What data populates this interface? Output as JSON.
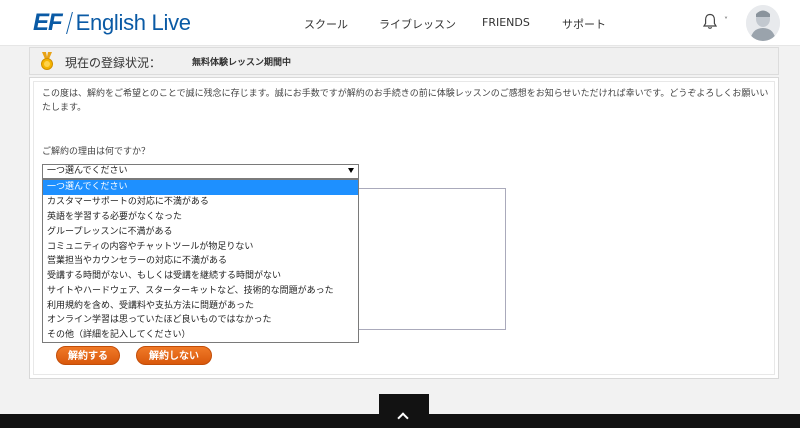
{
  "header": {
    "logo_mark": "EF",
    "logo_text": "English Live",
    "nav": [
      "スクール",
      "ライブレッスン",
      "FRIENDS",
      "サポート"
    ],
    "caret": "˅"
  },
  "status": {
    "label": "現在の登録状況：",
    "value": "無料体験レッスン期間中"
  },
  "form": {
    "intro": "この度は、解約をご希望とのことで誠に残念に存じます。誠にお手数ですが解約のお手続きの前に体験レッスンのご感想をお知らせいただければ幸いです。どうぞよろしくお願いいたします。",
    "reason_label": "ご解約の理由は何ですか？",
    "selected": "一つ選んでください",
    "options": [
      "一つ選んでください",
      "カスタマーサポートの対応に不満がある",
      "英語を学習する必要がなくなった",
      "グループレッスンに不満がある",
      "コミュニティの内容やチャットツールが物足りない",
      "営業担当やカウンセラーの対応に不満がある",
      "受講する時間がない、もしくは受講を継続する時間がない",
      "サイトやハードウェア、スターターキットなど、技術的な問題があった",
      "利用規約を含め、受講料や支払方法に問題があった",
      "オンライン学習は思っていたほど良いものではなかった",
      "その他（詳細を記入してください）"
    ],
    "cancel_button": "解約する",
    "keep_button": "解約しない"
  },
  "colors": {
    "brand": "#0a5aa5",
    "accent": "#e8640f",
    "highlight": "#1e90ff"
  }
}
